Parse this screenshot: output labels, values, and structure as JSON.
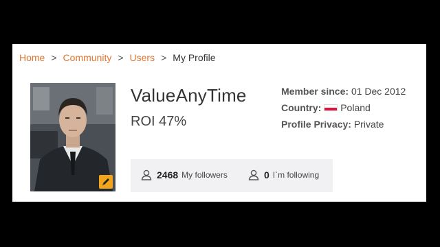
{
  "breadcrumb": {
    "items": [
      {
        "label": "Home"
      },
      {
        "label": "Community"
      },
      {
        "label": "Users"
      }
    ],
    "current": "My Profile",
    "separator": ">"
  },
  "profile": {
    "username": "ValueAnyTime",
    "roi": "ROI 47%",
    "avatar_icon": "user-photo",
    "edit_icon": "pencil-icon"
  },
  "meta": {
    "member_since_label": "Member since:",
    "member_since_value": "01 Dec 2012",
    "country_label": "Country:",
    "country_value": "Poland",
    "privacy_label": "Profile Privacy:",
    "privacy_value": "Private"
  },
  "follow": {
    "followers_count": "2468",
    "followers_label": "My followers",
    "following_count": "0",
    "following_label": "I`m following"
  },
  "colors": {
    "link": "#e0752f",
    "edit_badge": "#f2a51a",
    "follow_box": "#f1f1f3"
  }
}
